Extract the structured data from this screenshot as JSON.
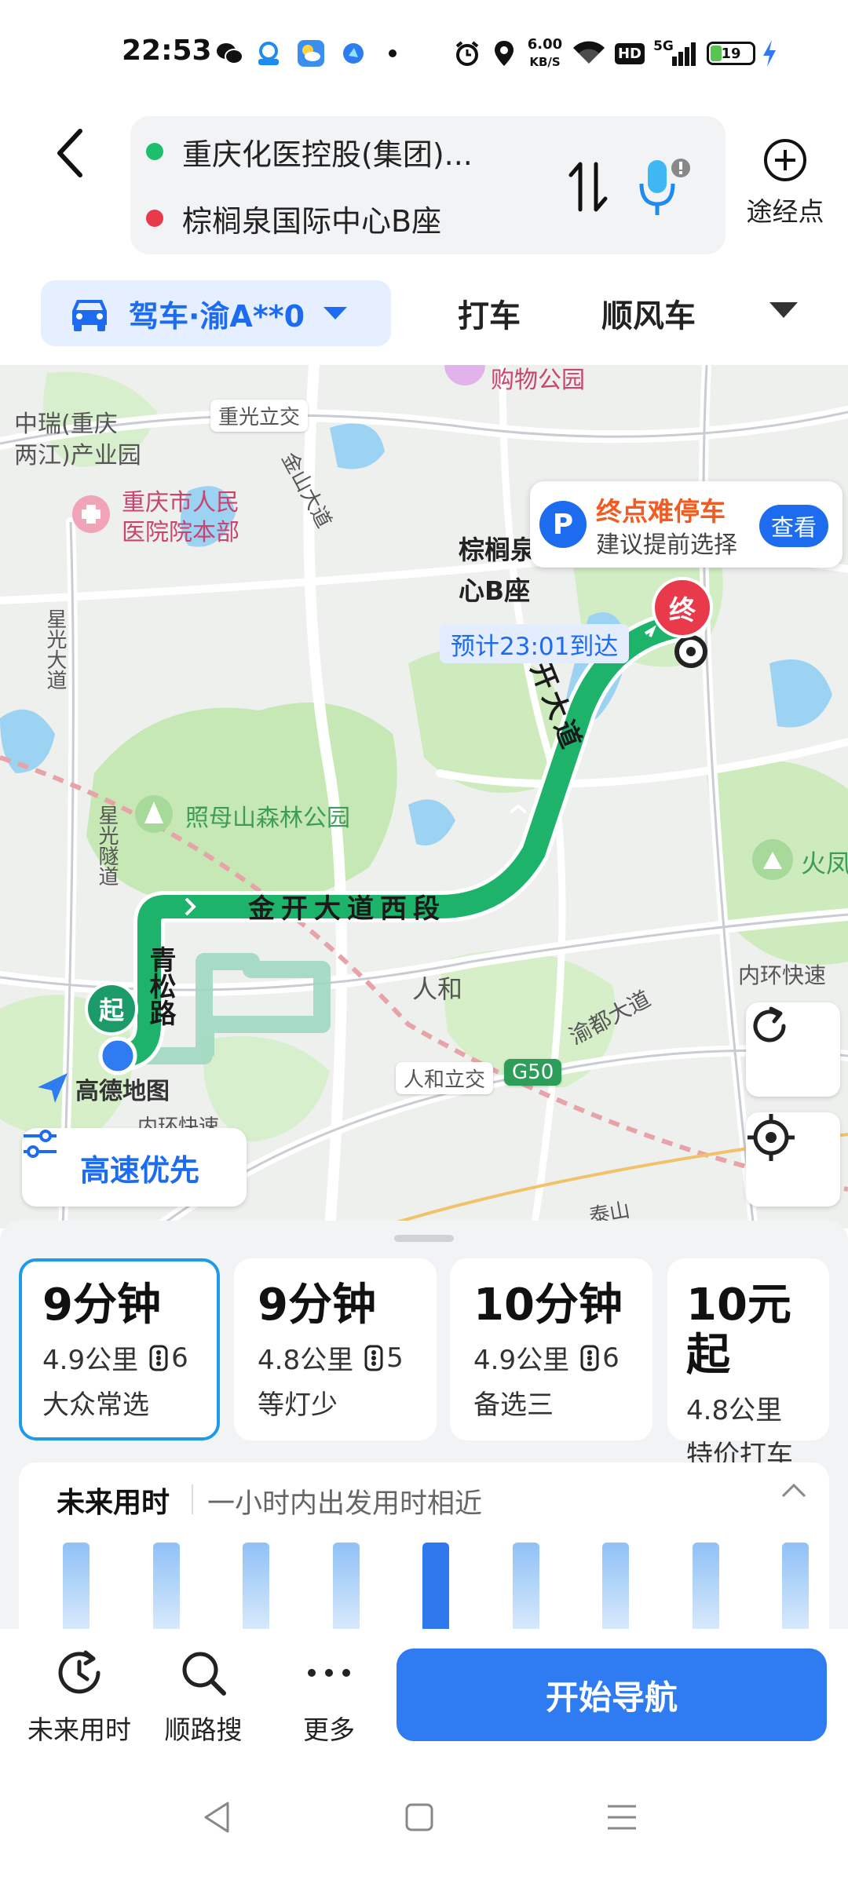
{
  "status_bar": {
    "time": "22:53",
    "net_speed_value": "6.00",
    "net_speed_unit": "KB/S",
    "hd_badge": "HD",
    "network": "5G",
    "battery": "19",
    "icons": [
      "wechat-icon",
      "app-icon",
      "weather-icon",
      "app-icon",
      "dot-icon",
      "alarm-icon",
      "location-icon",
      "wifi-icon",
      "signal-icon",
      "battery-icon",
      "charging-icon"
    ]
  },
  "route": {
    "origin": "重庆化医控股(集团)...",
    "destination": "棕榈泉国际中心B座",
    "origin_color": "#1cbf6c",
    "destination_color": "#e83a4b",
    "waypoint_label": "途经点"
  },
  "modes": {
    "drive": "驾车·渝A**0",
    "taxi": "打车",
    "carpool": "顺风车"
  },
  "map": {
    "labels": {
      "shopping_park": "购物公园",
      "zhongrui_1": "中瑞(重庆",
      "zhongrui_2": "两江)产业园",
      "chongguang": "重光立交",
      "hospital_1": "重庆市人民",
      "hospital_2": "医院院本部",
      "jinshan_ave": "金山大道",
      "xingguang_ave": "星光大道",
      "zhaomushan": "照母山森林公园",
      "xingguang_tunnel": "星光隧道",
      "renhe": "人和",
      "renhe_interchange": "人和立交",
      "g50": "G50",
      "inner_ring": "内环快速",
      "yudu_ave": "渝都大道",
      "huofeng": "火凤",
      "jinkai_east": "开大道",
      "amap": "高德地图",
      "inner_ring_bottom": "内环快速",
      "taishan": "泰山"
    },
    "destination_name_1": "棕榈泉",
    "destination_name_2": "心B座",
    "eta": "预计23:01到达",
    "route_road_1": "金开大道西段",
    "route_road_2": "青松路",
    "start_marker": "起",
    "end_marker": "终",
    "parking": {
      "title": "终点难停车",
      "subtitle": "建议提前选择",
      "button": "查看"
    },
    "highway_pref": "高速优先",
    "route_color": "#1db36b"
  },
  "route_options": [
    {
      "time": "9分钟",
      "distance": "4.9公里",
      "lights": "6",
      "name": "大众常选"
    },
    {
      "time": "9分钟",
      "distance": "4.8公里",
      "lights": "5",
      "name": "等灯少"
    },
    {
      "time": "10分钟",
      "distance": "4.9公里",
      "lights": "6",
      "name": "备选三"
    },
    {
      "time": "10元起",
      "distance": "4.8公里",
      "lights": "",
      "name": "特价打车"
    }
  ],
  "future": {
    "title": "未来用时",
    "subtitle": "一小时内出发用时相近",
    "active_bar_index": 4,
    "bar_count": 9
  },
  "actions": {
    "future_time": "未来用时",
    "search_along": "顺路搜",
    "more": "更多",
    "start_nav": "开始导航"
  }
}
